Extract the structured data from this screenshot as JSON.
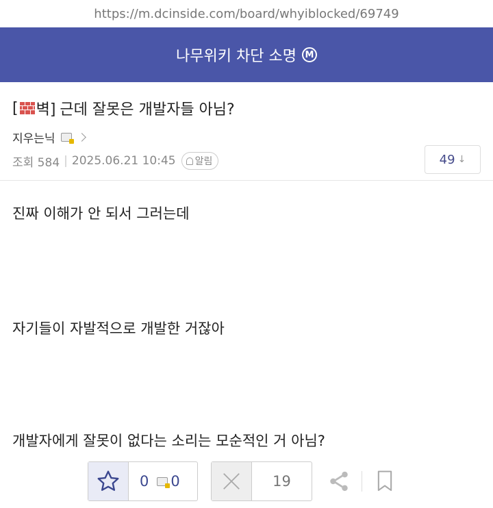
{
  "browser": {
    "url": "https://m.dcinside.com/board/whyiblocked/69749"
  },
  "gallery": {
    "title": "나무위키 차단 소명",
    "badge": "M"
  },
  "post": {
    "title_prefix_open": "[",
    "title_prefix_word": "벽]",
    "title": "근데 잘못은 개발자들 아님?",
    "author": "지우는닉",
    "views_label": "조회 584",
    "datetime": "2025.06.21 10:45",
    "alarm_label": "알림",
    "comment_count": "49",
    "comment_arrow": "↓",
    "body": [
      "진짜 이해가 안 되서 그러는데",
      "자기들이 자발적으로 개발한 거잖아",
      "개발자에게 잘못이 없다는 소리는 모순적인 거 아님?"
    ]
  },
  "actions": {
    "recommend_count": "0",
    "fixed_recommend_count": "0",
    "not_recommend_count": "19"
  }
}
